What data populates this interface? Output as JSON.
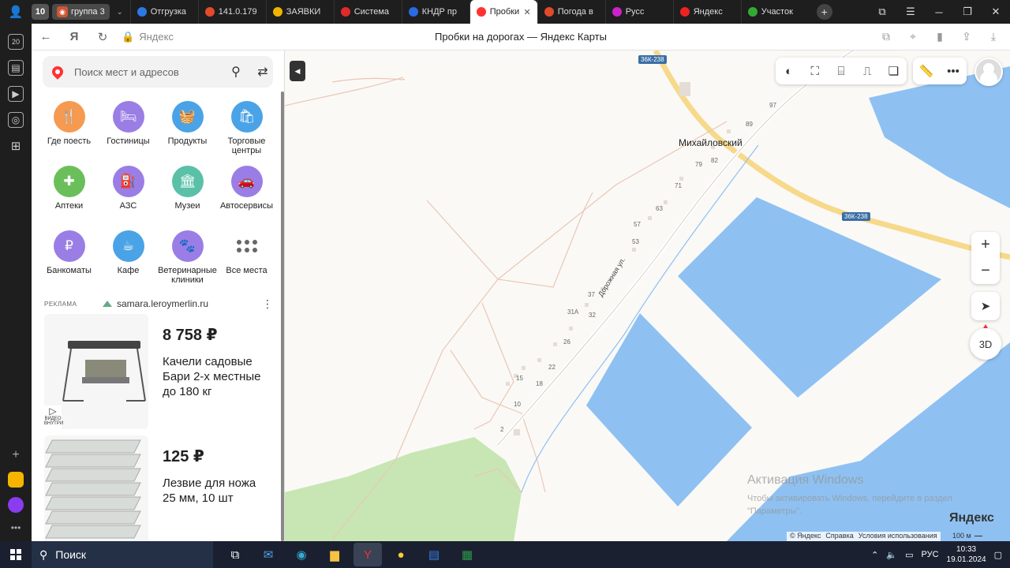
{
  "browser": {
    "tab_group": {
      "count": "10",
      "name": "группа 3"
    },
    "tabs": [
      {
        "label": "Отгрузка",
        "color": "#2a7ae2"
      },
      {
        "label": "141.0.179",
        "color": "#e24a2a"
      },
      {
        "label": "ЗАЯВКИ",
        "color": "#f0b400"
      },
      {
        "label": "Система",
        "color": "#e22a2a"
      },
      {
        "label": "КНДР пр",
        "color": "#2a6ae2"
      },
      {
        "label": "Пробки",
        "color": "#f33"
      },
      {
        "label": "Погода в",
        "color": "#e24a2a"
      },
      {
        "label": "Русс",
        "color": "#c2c"
      },
      {
        "label": "Яндекс",
        "color": "#e22"
      },
      {
        "label": "Участок",
        "color": "#3a3"
      }
    ],
    "address_domain": "Яндекс",
    "page_title": "Пробки на дорогах — Яндекс Карты"
  },
  "panel": {
    "search_placeholder": "Поиск мест и адресов",
    "categories": [
      {
        "label": "Где поесть",
        "color": "#f59a50",
        "icon": "fork-knife-icon",
        "glyph": "🍴"
      },
      {
        "label": "Гостиницы",
        "color": "#9a7ee6",
        "icon": "bed-icon",
        "glyph": "🛏"
      },
      {
        "label": "Продукты",
        "color": "#4aa3e6",
        "icon": "basket-icon",
        "glyph": "🧺"
      },
      {
        "label": "Торговые центры",
        "color": "#4aa3e6",
        "icon": "shopping-bag-icon",
        "glyph": "🛍"
      },
      {
        "label": "Аптеки",
        "color": "#6bbf5a",
        "icon": "pharmacy-cross-icon",
        "glyph": "✚"
      },
      {
        "label": "АЗС",
        "color": "#9a7ee6",
        "icon": "fuel-icon",
        "glyph": "⛽"
      },
      {
        "label": "Музеи",
        "color": "#5ac0a8",
        "icon": "museum-icon",
        "glyph": "🏛"
      },
      {
        "label": "Автосервисы",
        "color": "#9a7ee6",
        "icon": "car-service-icon",
        "glyph": "🚗"
      },
      {
        "label": "Банкоматы",
        "color": "#9a7ee6",
        "icon": "ruble-icon",
        "glyph": "₽"
      },
      {
        "label": "Кафе",
        "color": "#4aa3e6",
        "icon": "coffee-cup-icon",
        "glyph": "☕"
      },
      {
        "label": "Ветеринарные клиники",
        "color": "#9a7ee6",
        "icon": "pet-icon",
        "glyph": "🐾"
      },
      {
        "label": "Все места",
        "color": "",
        "icon": "dots-grid-icon",
        "glyph": ""
      }
    ],
    "ad": {
      "label": "РЕКЛАМА",
      "domain": "samara.leroymerlin.ru",
      "video_badge": "ВИДЕО ВНУТРИ",
      "products": [
        {
          "price": "8 758 ₽",
          "name": "Качели садовые Бари 2-х местные до 180 кг"
        },
        {
          "price": "125 ₽",
          "name": "Лезвие для ножа 25 мм, 10 шт"
        }
      ]
    }
  },
  "map": {
    "town": "Михайловский",
    "street": "Дорожная ул.",
    "road_shields": [
      "36К-238",
      "36К-238"
    ],
    "house_numbers": [
      "97",
      "89",
      "82",
      "79",
      "71",
      "63",
      "57",
      "53",
      "37",
      "31А",
      "32",
      "26",
      "22",
      "18",
      "15",
      "10",
      "2"
    ],
    "watermark_title": "Активация Windows",
    "watermark_text": "Чтобы активировать Windows, перейдите в раздел \"Параметры\".",
    "logo": "Яндекс",
    "copyright": [
      "© Яндекс",
      "Справка",
      "Условия использования"
    ],
    "scale": "100 м",
    "btn_3d": "3D",
    "colors": {
      "water": "#8ec1f2",
      "forest": "#c7e6b3",
      "road_major": "#f6d98a",
      "land": "#fbf9f6"
    }
  },
  "taskbar": {
    "search_label": "Поиск",
    "lang": "РУС",
    "time": "10:33",
    "date": "19.01.2024"
  }
}
